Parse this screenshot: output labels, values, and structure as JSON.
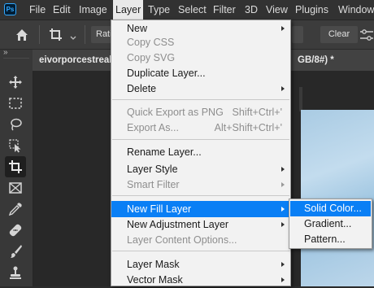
{
  "menubar": {
    "logo": "Ps",
    "items": [
      "File",
      "Edit",
      "Image",
      "Layer",
      "Type",
      "Select",
      "Filter",
      "3D",
      "View",
      "Plugins",
      "Window"
    ],
    "active": "Layer"
  },
  "options_bar": {
    "ratio_label": "Ratio",
    "clear_label": "Clear"
  },
  "document_tab": {
    "title_left": "eivorporcestreal",
    "title_right": "GB/8#) *"
  },
  "toolbar": {
    "collapse_glyph": "»",
    "tools": [
      "move-tool",
      "marquee-tool",
      "lasso-tool",
      "object-selection-tool",
      "crop-tool",
      "frame-tool",
      "eyedropper-tool",
      "healing-brush-tool",
      "brush-tool",
      "stamp-tool"
    ],
    "selected": "crop-tool"
  },
  "layer_menu": {
    "items": [
      {
        "label": "New",
        "submenu": true,
        "enabled": true
      },
      {
        "label": "Copy CSS",
        "enabled": false
      },
      {
        "label": "Copy SVG",
        "enabled": false
      },
      {
        "label": "Duplicate Layer...",
        "enabled": true
      },
      {
        "label": "Delete",
        "submenu": true,
        "enabled": true
      },
      {
        "label": "Quick Export as PNG",
        "shortcut": "Shift+Ctrl+'",
        "enabled": false
      },
      {
        "label": "Export As...",
        "shortcut": "Alt+Shift+Ctrl+'",
        "enabled": false
      },
      {
        "label": "Rename Layer...",
        "enabled": true
      },
      {
        "label": "Layer Style",
        "submenu": true,
        "enabled": true
      },
      {
        "label": "Smart Filter",
        "submenu": true,
        "enabled": false
      },
      {
        "label": "New Fill Layer",
        "submenu": true,
        "enabled": true,
        "highlighted": true
      },
      {
        "label": "New Adjustment Layer",
        "submenu": true,
        "enabled": true
      },
      {
        "label": "Layer Content Options...",
        "enabled": false
      },
      {
        "label": "Layer Mask",
        "submenu": true,
        "enabled": true
      },
      {
        "label": "Vector Mask",
        "submenu": true,
        "enabled": true
      }
    ]
  },
  "fill_layer_submenu": {
    "items": [
      {
        "label": "Solid Color...",
        "highlighted": true
      },
      {
        "label": "Gradient..."
      },
      {
        "label": "Pattern..."
      }
    ]
  },
  "colors": {
    "highlight": "#0a7ff5",
    "menu_bg": "#f2f2f2",
    "app_bg": "#2b2b2b",
    "ps_blue": "#31a8ff"
  }
}
